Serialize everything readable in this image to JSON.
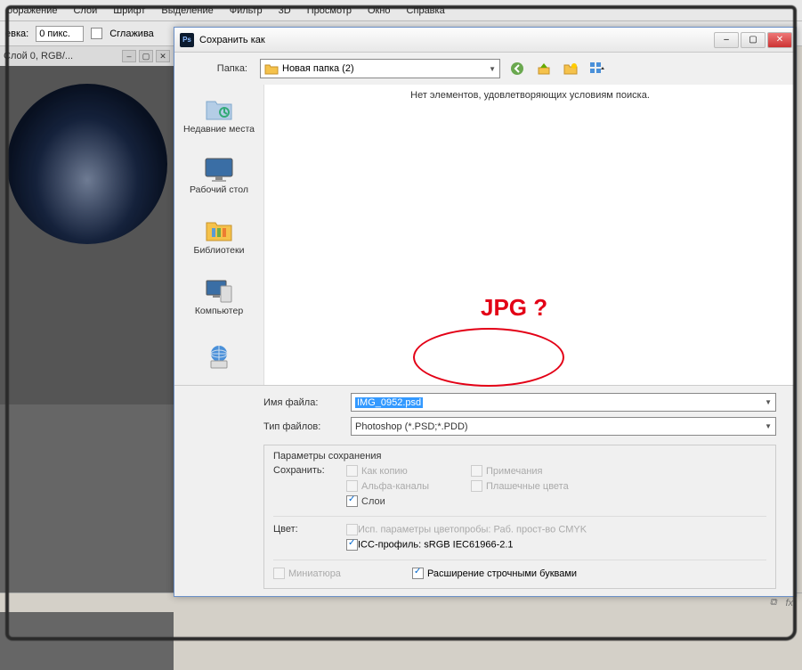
{
  "menu": [
    "ображение",
    "Слои",
    "Шрифт",
    "Выделение",
    "Фильтр",
    "3D",
    "Просмотр",
    "Окно",
    "Справка"
  ],
  "options": {
    "fit_label": "евка:",
    "fit_value": "0 пикс.",
    "smooth_label": "Сглажива"
  },
  "doc": {
    "title": "Слой 0, RGB/..."
  },
  "dialog": {
    "title": "Сохранить как",
    "folder_label": "Папка:",
    "folder_value": "Новая папка (2)",
    "empty_msg": "Нет элементов, удовлетворяющих условиям поиска.",
    "places": [
      "Недавние места",
      "Рабочий стол",
      "Библиотеки",
      "Компьютер",
      ""
    ],
    "filename_label": "Имя файла:",
    "filename_value": "IMG_0952.psd",
    "filetype_label": "Тип файлов:",
    "filetype_value": "Photoshop (*.PSD;*.PDD)"
  },
  "saveopts": {
    "heading": "Параметры сохранения",
    "save_label": "Сохранить:",
    "as_copy": "Как копию",
    "notes": "Примечания",
    "alpha": "Альфа-каналы",
    "spot": "Плашечные цвета",
    "layers": "Слои",
    "color_label": "Цвет:",
    "proof": "Исп. параметры цветопробы:  Раб. прост-во CMYK",
    "icc": "ICC-профиль:  sRGB IEC61966-2.1",
    "thumb": "Миниатюра",
    "lower": "Расширение строчными буквами"
  },
  "annot": "JPG ?",
  "status": {
    "fx": "fx"
  }
}
